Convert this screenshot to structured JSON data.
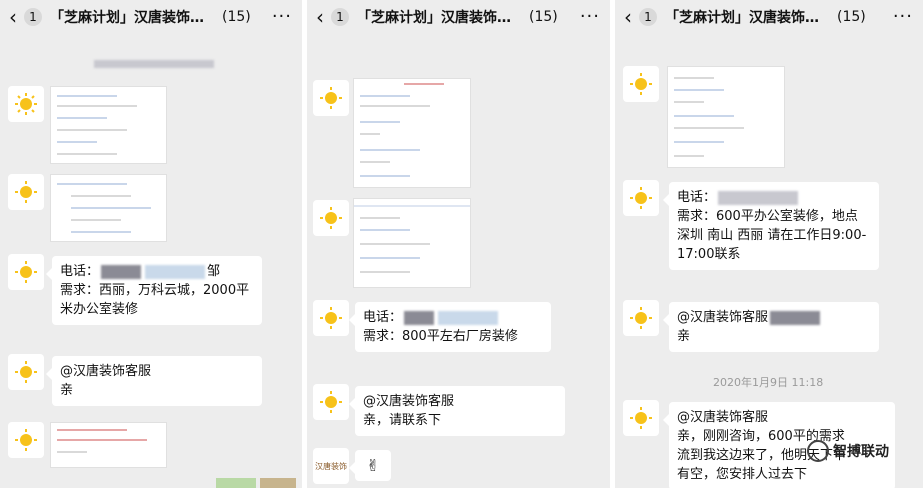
{
  "chat": {
    "title": "「芝麻计划」汉唐装饰…",
    "count": "(15)",
    "badge": "1"
  },
  "panel1": {
    "msg_contact_label": "电话：",
    "msg_contact_tail": "邹",
    "msg_requirement": "需求：西丽，万科云城，2000平米办公室装修",
    "msg_mention": "@汉唐装饰客服",
    "msg_mention_line2": "亲"
  },
  "panel2": {
    "msg_contact_label": "电话：",
    "msg_requirement": "需求：800平左右厂房装修",
    "msg_mention": "@汉唐装饰客服",
    "msg_mention_line2": "亲，请联系下",
    "sticker": "✌",
    "avatar_logo_text": "汉唐装饰"
  },
  "panel3": {
    "msg_contact_label": "电话：",
    "msg_requirement": "需求：600平办公室装修，地点 深圳 南山 西丽 请在工作日9:00-17:00联系",
    "msg_mention": "@汉唐装饰客服",
    "msg_mention_line2": "亲",
    "timestamp": "2020年1月9日 11:18",
    "msg_last_line1": "@汉唐装饰客服",
    "msg_last_line2": "亲，刚刚咨询，600平的需求",
    "msg_last_line3": "流到我这边来了，他明天下午",
    "msg_last_line4": "有空，您安排人过去下",
    "watermark": "智搏联动"
  }
}
